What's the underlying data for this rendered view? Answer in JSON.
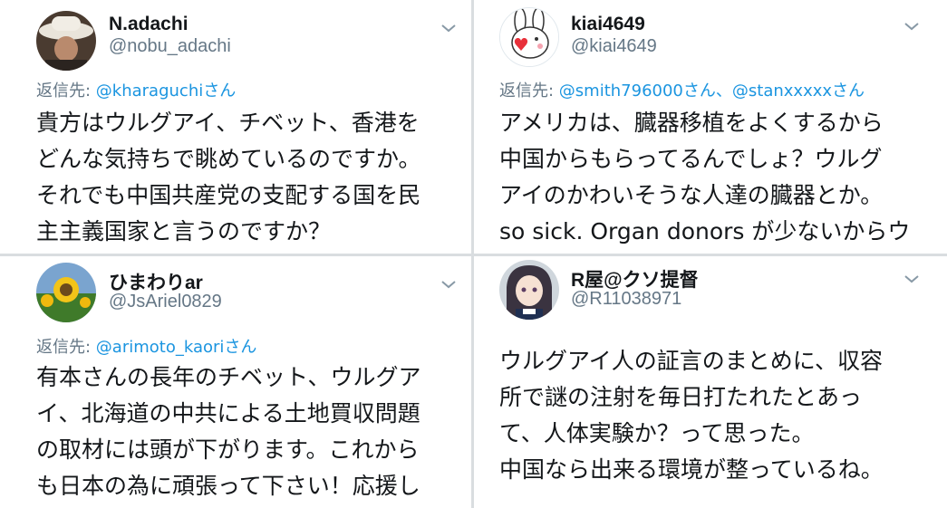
{
  "tweets": [
    {
      "name": "N.adachi",
      "handle": "@nobu_adachi",
      "avatar_icon": "man-in-hat-avatar",
      "reply_prefix": "返信先: ",
      "reply_mentions": "@kharaguchiさん",
      "lines": [
        "貴方はウルグアイ、チベット、香港を",
        "どんな気持ちで眺めているのですか。",
        "それでも中国共産党の支配する国を民",
        "主主義国家と言うのですか？"
      ]
    },
    {
      "name": "ひまわりar",
      "handle": "@JsAriel0829",
      "avatar_icon": "sunflower-avatar",
      "reply_prefix": "返信先: ",
      "reply_mentions": "@arimoto_kaoriさん",
      "lines": [
        "有本さんの長年のチベット、ウルグア",
        "イ、北海道の中共による土地買収問題",
        "の取材には頭が下がります。これから",
        "も日本の為に頑張って下さい！応援し"
      ]
    },
    {
      "name": "kiai4649",
      "handle": "@kiai4649",
      "avatar_icon": "bunny-sticker-avatar",
      "reply_prefix": "返信先: ",
      "reply_mentions": "@smith796000さん、@stanxxxxxさん",
      "lines": [
        "アメリカは、臓器移植をよくするから",
        "中国からもらってるんでしょ？ウルグ",
        "アイのかわいそうな人達の臓器とか。",
        "so sick. Organ donors が少ないからウ"
      ]
    },
    {
      "name": "R屋@クソ提督",
      "handle": "@R11038971",
      "avatar_icon": "anime-girl-avatar",
      "lines": [
        "ウルグアイ人の証言のまとめに、収容",
        "所で謎の注射を毎日打たれたとあっ",
        "て、人体実験か？って思った。",
        "中国なら出来る環境が整っているね。"
      ]
    }
  ],
  "colors": {
    "name": "#14171a",
    "handle": "#657786",
    "mention": "#1b95e0",
    "background": "#d9dde0"
  }
}
